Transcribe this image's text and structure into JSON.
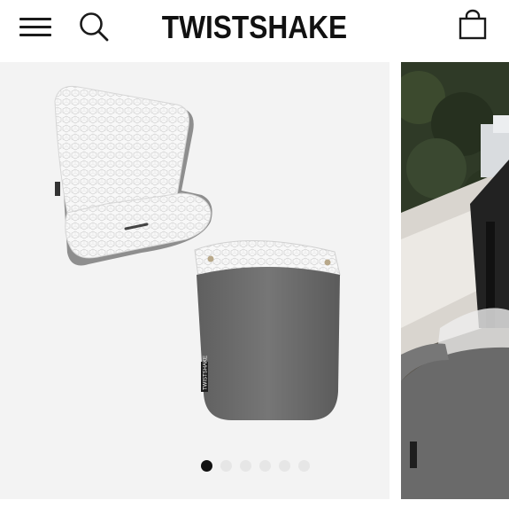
{
  "header": {
    "brand": "TWISTSHAKE",
    "menu_icon": "hamburger-menu-icon",
    "search_icon": "search-icon",
    "cart_icon": "shopping-bag-icon"
  },
  "carousel": {
    "slides": [
      {
        "image": "product-image-seat-liner-and-footmuff",
        "product_tag": "TWISTSHAKE"
      },
      {
        "image": "product-image-stroller-outdoor",
        "product_tag": "TWISTSHAKE"
      }
    ],
    "slide_count": 6,
    "active_index": 0
  },
  "colors": {
    "text": "#111111",
    "slide_background": "#f3f3f3",
    "footmuff_grey": "#6f6f6f",
    "pattern_white": "#f7f7f7",
    "dot_inactive": "#e6e6e6",
    "dot_active": "#111111"
  }
}
